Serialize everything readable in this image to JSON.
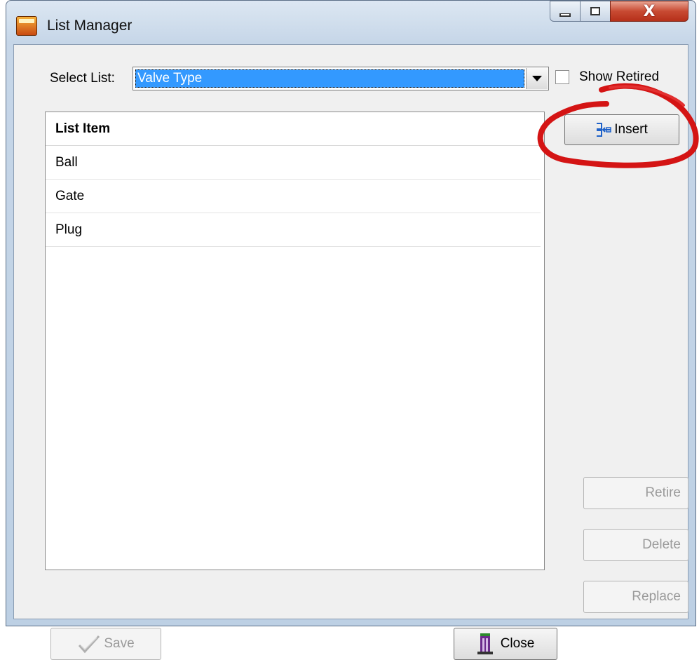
{
  "window": {
    "title": "List Manager",
    "controls": {
      "minimize": "minimize",
      "maximize": "maximize",
      "close": "X"
    }
  },
  "select_list": {
    "label": "Select List:",
    "value": "Valve Type"
  },
  "show_retired": {
    "label": "Show Retired",
    "checked": false
  },
  "list": {
    "header": "List Item",
    "items": [
      "Ball",
      "Gate",
      "Plug"
    ]
  },
  "buttons": {
    "insert": "Insert",
    "retire": "Retire",
    "delete": "Delete",
    "replace": "Replace",
    "save": "Save",
    "close": "Close"
  },
  "icons": {
    "app": "app-logo-icon",
    "insert": "insert-row-icon",
    "save": "checkmark-icon",
    "close": "exit-door-icon"
  },
  "colors": {
    "selection": "#3399ff",
    "annotation": "#d41414",
    "titlebar": "#c6d6e8",
    "close_button": "#c84a32"
  }
}
